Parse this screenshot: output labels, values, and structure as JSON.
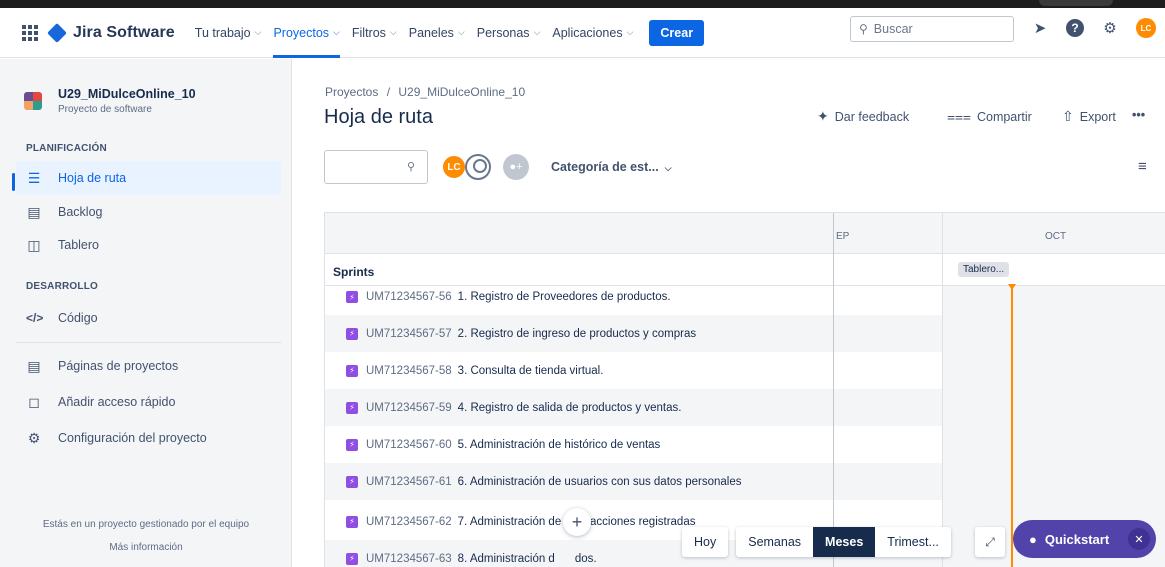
{
  "topnav": {
    "product": "Jira Software",
    "items": [
      {
        "label": "Tu trabajo",
        "active": false
      },
      {
        "label": "Proyectos",
        "active": true
      },
      {
        "label": "Filtros",
        "active": false
      },
      {
        "label": "Paneles",
        "active": false
      },
      {
        "label": "Personas",
        "active": false
      },
      {
        "label": "Aplicaciones",
        "active": false
      }
    ],
    "create_label": "Crear",
    "search_placeholder": "Buscar",
    "avatar_initials": "LC",
    "accent": "#0c66e4"
  },
  "sidebar": {
    "project_name": "U29_MiDulceOnline_10",
    "project_type": "Proyecto de software",
    "section_planning": "PLANIFICACIÓN",
    "planning_items": [
      {
        "label": "Hoja de ruta",
        "icon": "roadmap-icon",
        "active": true
      },
      {
        "label": "Backlog",
        "icon": "backlog-icon",
        "active": false
      },
      {
        "label": "Tablero",
        "icon": "board-icon",
        "active": false
      }
    ],
    "section_dev": "DESARROLLO",
    "dev_items": [
      {
        "label": "Código",
        "icon": "code-icon"
      }
    ],
    "extra_items": [
      {
        "label": "Páginas de proyectos",
        "icon": "pages-icon"
      },
      {
        "label": "Añadir acceso rápido",
        "icon": "add-shortcut-icon"
      },
      {
        "label": "Configuración del proyecto",
        "icon": "gear-icon"
      }
    ],
    "footer_text": "Estás en un proyecto gestionado por el equipo",
    "footer_link": "Más información"
  },
  "page": {
    "breadcrumb_root": "Proyectos",
    "breadcrumb_sep": "/",
    "breadcrumb_project": "U29_MiDulceOnline_10",
    "title": "Hoja de ruta",
    "feedback_label": "Dar feedback",
    "share_label": "Compartir",
    "export_label": "Export",
    "more_label": "•••"
  },
  "filters": {
    "avatar_initials": "LC",
    "category_label": "Categoría de est..."
  },
  "roadmap": {
    "month_left": "EP",
    "month_right": "OCT",
    "sprints_label": "Sprints",
    "sprint_chip": "Tablero...",
    "issues": [
      {
        "key": "UM71234567-56",
        "summary": "1. Registro de Proveedores de productos."
      },
      {
        "key": "UM71234567-57",
        "summary": "2. Registro de ingreso de productos y compras"
      },
      {
        "key": "UM71234567-58",
        "summary": "3. Consulta de tienda virtual."
      },
      {
        "key": "UM71234567-59",
        "summary": "4. Registro de salida de productos y ventas."
      },
      {
        "key": "UM71234567-60",
        "summary": "5. Administración de histórico de ventas"
      },
      {
        "key": "UM71234567-61",
        "summary": "6. Administración de usuarios con sus datos personales"
      },
      {
        "key": "UM71234567-62",
        "summary": "7. Administración de transacciones registradas"
      },
      {
        "key": "UM71234567-63",
        "summary": "8. Administración d",
        "summary_tail": "dos."
      }
    ]
  },
  "controls": {
    "today": "Hoy",
    "weeks": "Semanas",
    "months": "Meses",
    "quarters": "Trimest...",
    "selected": "Meses"
  },
  "quickstart": {
    "label": "Quickstart",
    "color": "#5243aa"
  }
}
